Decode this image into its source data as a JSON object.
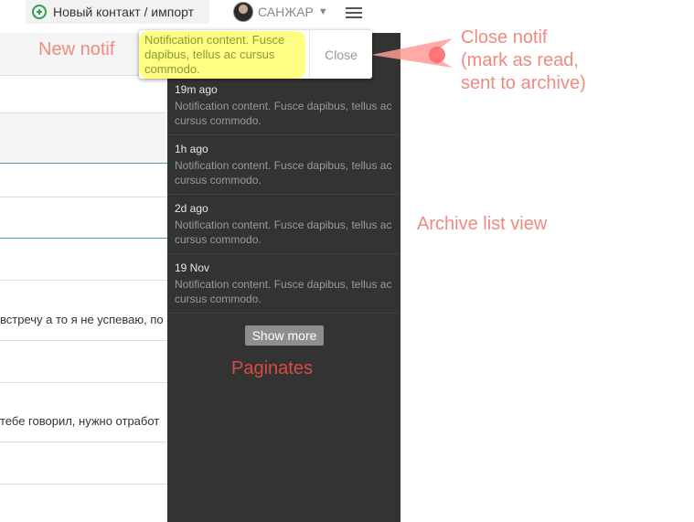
{
  "topbar": {
    "add_contact_label": "Новый контакт / импорт",
    "user_name": "САНЖАР"
  },
  "background": {
    "snippet_1": "встречу а то я не успеваю, по",
    "snippet_2": "тебе говорил, нужно отработ"
  },
  "popup": {
    "content": "Notification content. Fusce dapibus, tellus ac cursus commodo.",
    "close_label": "Close"
  },
  "archive": {
    "items": [
      {
        "time": "19m ago",
        "content": "Notification content. Fusce dapibus, tellus ac cursus commodo."
      },
      {
        "time": "1h ago",
        "content": "Notification content. Fusce dapibus, tellus ac cursus commodo."
      },
      {
        "time": "2d ago",
        "content": "Notification content. Fusce dapibus, tellus ac cursus commodo."
      },
      {
        "time": "19 Nov",
        "content": "Notification content. Fusce dapibus, tellus ac cursus commodo."
      }
    ],
    "show_more_label": "Show more"
  },
  "annotations": {
    "new_notif": "New notif",
    "close_notif_1": "Close notif",
    "close_notif_2": "(mark as read,",
    "close_notif_3": "sent to archive)",
    "archive_list_view": "Archive list view",
    "paginates": "Paginates"
  },
  "colors": {
    "panel_bg": "#333333",
    "highlight": "#ffff5a",
    "annotation": "#f08a80",
    "annotation_dark": "#d94b44",
    "accent_green": "#2aa14a"
  },
  "icons": [
    "plus-circle-icon",
    "avatar",
    "chevron-down-icon",
    "list-menu-icon",
    "arrow-icon"
  ]
}
